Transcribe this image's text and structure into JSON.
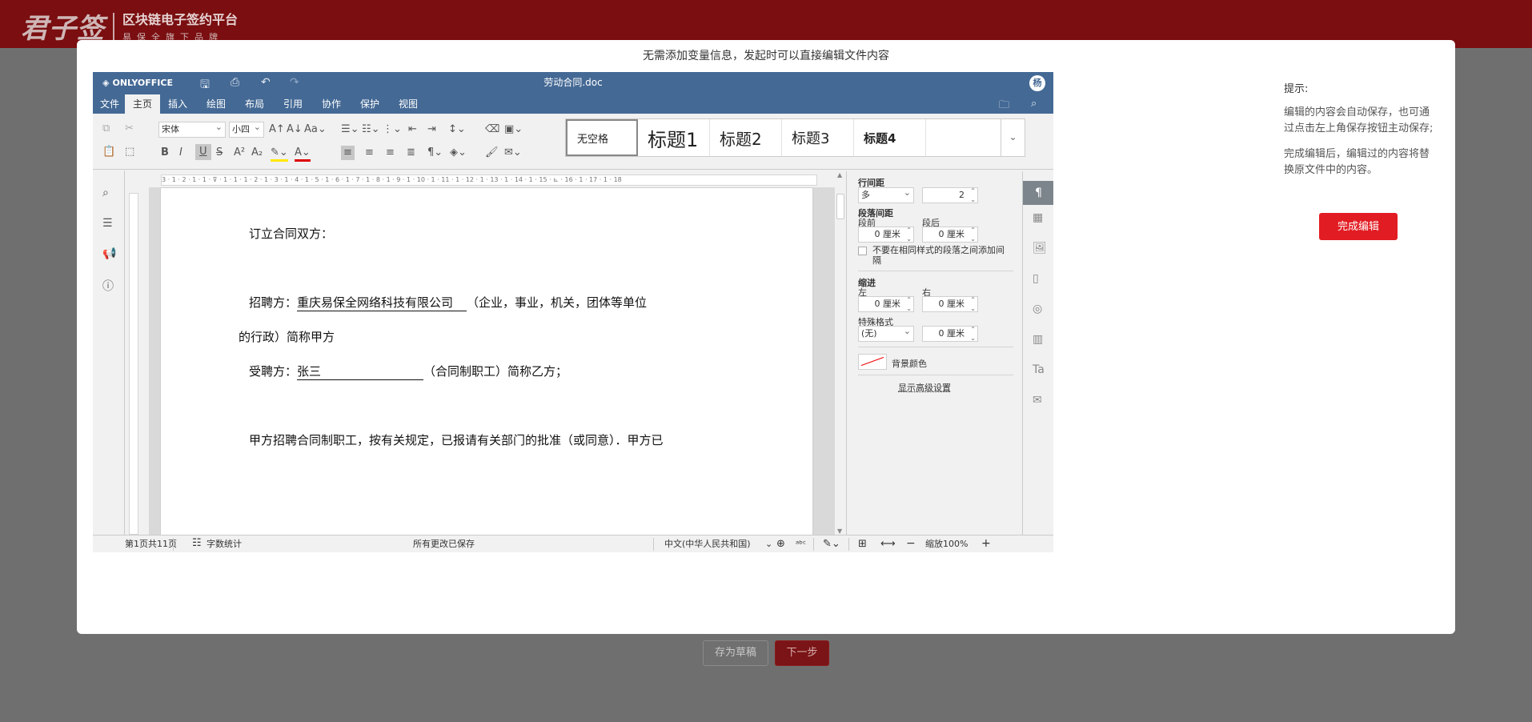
{
  "brand": {
    "logo_text": "君子签",
    "title": "区块链电子签约平台",
    "subtitle": "易保全旗下品牌"
  },
  "modal": {
    "title": "无需添加变量信息，发起时可以直接编辑文件内容"
  },
  "editor": {
    "app_name": "ONLYOFFICE",
    "doc_title": "劳动合同.doc",
    "avatar": "杨",
    "menu": [
      "文件",
      "主页",
      "插入",
      "绘图",
      "布局",
      "引用",
      "协作",
      "保护",
      "视图"
    ],
    "active_menu": "主页",
    "font_name": "宋体",
    "font_size": "小四",
    "styles": [
      "无空格",
      "标题1",
      "标题2",
      "标题3",
      "标题4"
    ],
    "ruler": "3 · 1 · 2 · 1 · 1 · ⊽ · 1 · 1 · 1 · 2 · 1 · 3 · 1 · 4 · 1 · 5 · 1 · 6 · 1 · 7 · 1 · 8 · 1 · 9 · 1 · 10 · 1 · 11 · 1 · 12 · 1 · 13 · 1 · 14 · 1 · 15 · ⊾ · 16 · 1 · 17 · 1 · 18",
    "document": {
      "line1": "订立合同双方：",
      "line2_label": "招聘方：",
      "line2_value": " 重庆易保全网络科技有限公司 ",
      "line2_suffix": "（企业，事业，机关，团体等单位",
      "line3": "的行政）简称甲方",
      "line4_label": "受聘方：",
      "line4_value": "  张三",
      "line4_suffix": "（合同制职工）简称乙方；",
      "line5": "甲方招聘合同制职工，按有关规定，已报请有关部门的批准（或同意）．甲方已"
    },
    "panel": {
      "line_spacing_label": "行间距",
      "line_spacing_type": "多",
      "line_spacing_value": "2",
      "para_spacing_label": "段落间距",
      "before_label": "段前",
      "after_label": "段后",
      "before_value": "0 厘米",
      "after_value": "0 厘米",
      "checkbox_label": "不要在相同样式的段落之间添加间隔",
      "indent_label": "缩进",
      "left_label": "左",
      "right_label": "右",
      "left_value": "0 厘米",
      "right_value": "0 厘米",
      "special_label": "特殊格式",
      "special_value": "(无)",
      "special_amount": "0 厘米",
      "bg_color_label": "背景颜色",
      "advanced_link": "显示高级设置"
    },
    "status": {
      "page": "第1页共11页",
      "word_count": "字数统计",
      "saved": "所有更改已保存",
      "language": "中文(中华人民共和国)",
      "zoom": "缩放100%"
    }
  },
  "hint": {
    "title": "提示:",
    "p1": "编辑的内容会自动保存，也可通过点击左上角保存按钮主动保存;",
    "p2": "完成编辑后，编辑过的内容将替换原文件中的内容。",
    "button": "完成编辑"
  },
  "footer": {
    "draft": "存为草稿",
    "next": "下一步"
  }
}
